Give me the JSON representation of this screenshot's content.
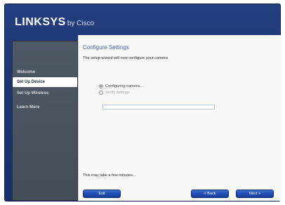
{
  "app": {
    "brand": "LINKSYS",
    "brand_suffix": "by Cisco"
  },
  "sidebar": {
    "items": [
      {
        "label": "Welcome",
        "active": false
      },
      {
        "label": "Set Up Device",
        "active": true
      },
      {
        "label": "Set Up Wireless",
        "active": false
      },
      {
        "label": "Learn More",
        "active": false
      }
    ]
  },
  "main": {
    "title": "Configure Settings",
    "description": "The setup wizard will now configure your camera",
    "steps": [
      {
        "label": "Configuring camera...",
        "state": "in-progress"
      },
      {
        "label": "Verify settings",
        "state": "pending"
      }
    ],
    "progress_percent": 0,
    "status_message": "This may take a few minutes..."
  },
  "footer": {
    "exit_label": "Exit",
    "back_label": "< Back",
    "next_label": "Next >"
  },
  "colors": {
    "frame": "#1b3470",
    "sidebar": "#4e5966",
    "title": "#3f67b5",
    "button": "#1f4cb0"
  }
}
